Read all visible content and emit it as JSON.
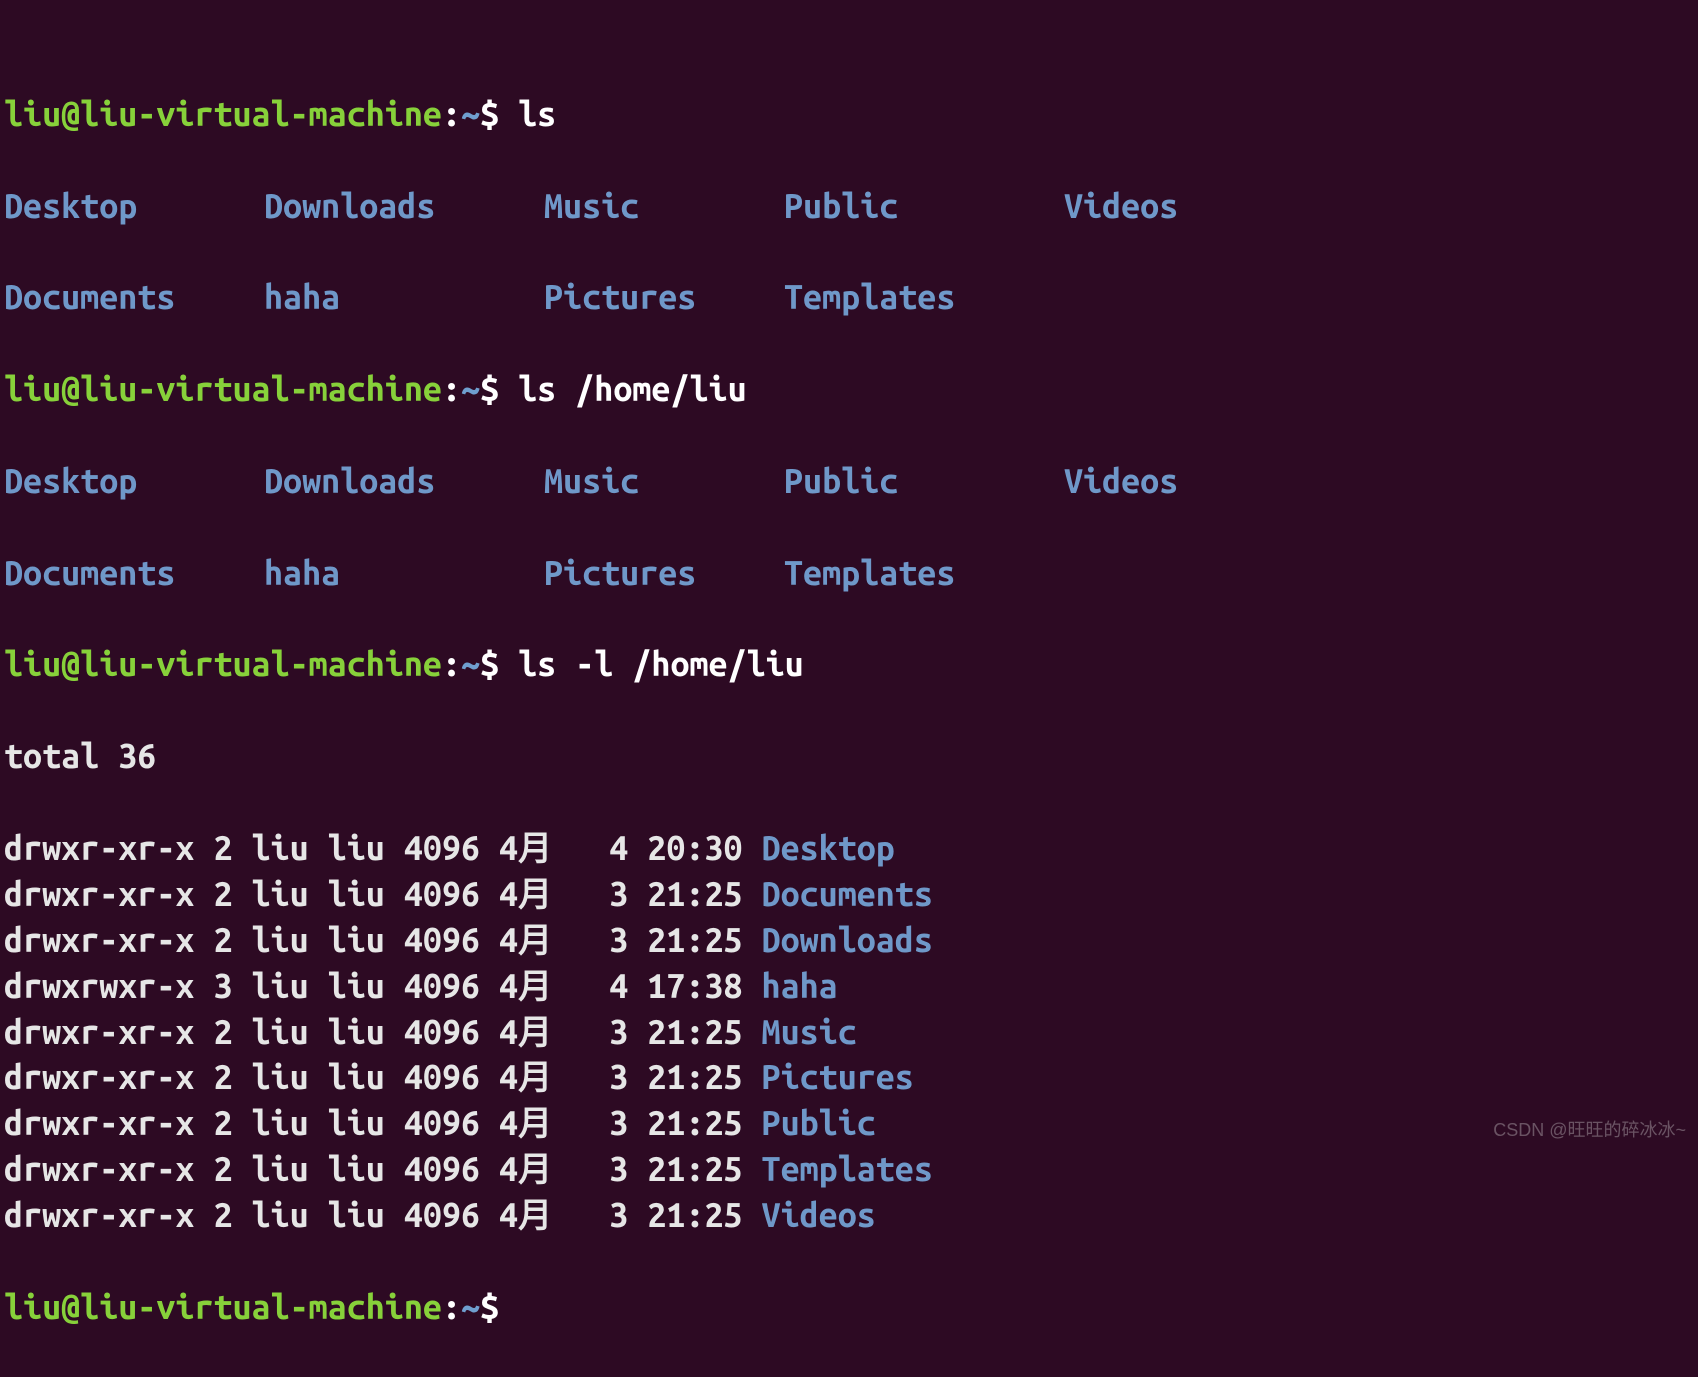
{
  "prompt": {
    "user": "liu",
    "at": "@",
    "host": "liu-virtual-machine",
    "colon": ":",
    "cwd": "~",
    "dollar": "$"
  },
  "commands": {
    "c1": "ls",
    "c2": "ls /home/liu",
    "c3": "ls -l /home/liu",
    "c4": ""
  },
  "listing_columns": {
    "row1": [
      "Desktop",
      "Downloads",
      "Music",
      "Public",
      "Videos"
    ],
    "row2": [
      "Documents",
      "haha",
      "Pictures",
      "Templates"
    ]
  },
  "long_listing": {
    "total": "total 36",
    "rows": [
      {
        "perm": "drwxr-xr-x",
        "n": "2",
        "u": "liu",
        "g": "liu",
        "size": "4096",
        "month": "4月",
        "day": "4",
        "time": "20:30",
        "name": "Desktop"
      },
      {
        "perm": "drwxr-xr-x",
        "n": "2",
        "u": "liu",
        "g": "liu",
        "size": "4096",
        "month": "4月",
        "day": "3",
        "time": "21:25",
        "name": "Documents"
      },
      {
        "perm": "drwxr-xr-x",
        "n": "2",
        "u": "liu",
        "g": "liu",
        "size": "4096",
        "month": "4月",
        "day": "3",
        "time": "21:25",
        "name": "Downloads"
      },
      {
        "perm": "drwxrwxr-x",
        "n": "3",
        "u": "liu",
        "g": "liu",
        "size": "4096",
        "month": "4月",
        "day": "4",
        "time": "17:38",
        "name": "haha"
      },
      {
        "perm": "drwxr-xr-x",
        "n": "2",
        "u": "liu",
        "g": "liu",
        "size": "4096",
        "month": "4月",
        "day": "3",
        "time": "21:25",
        "name": "Music"
      },
      {
        "perm": "drwxr-xr-x",
        "n": "2",
        "u": "liu",
        "g": "liu",
        "size": "4096",
        "month": "4月",
        "day": "3",
        "time": "21:25",
        "name": "Pictures"
      },
      {
        "perm": "drwxr-xr-x",
        "n": "2",
        "u": "liu",
        "g": "liu",
        "size": "4096",
        "month": "4月",
        "day": "3",
        "time": "21:25",
        "name": "Public"
      },
      {
        "perm": "drwxr-xr-x",
        "n": "2",
        "u": "liu",
        "g": "liu",
        "size": "4096",
        "month": "4月",
        "day": "3",
        "time": "21:25",
        "name": "Templates"
      },
      {
        "perm": "drwxr-xr-x",
        "n": "2",
        "u": "liu",
        "g": "liu",
        "size": "4096",
        "month": "4月",
        "day": "3",
        "time": "21:25",
        "name": "Videos"
      }
    ]
  },
  "watermark": "CSDN @旺旺的碎冰冰~"
}
